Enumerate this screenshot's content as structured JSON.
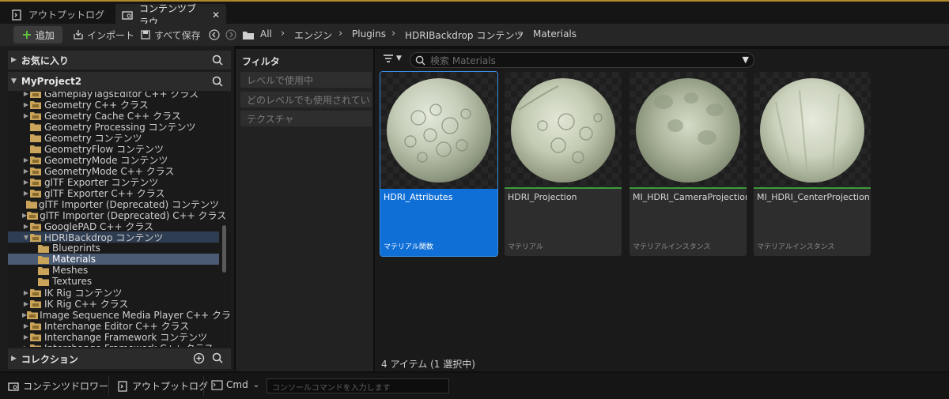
{
  "tabs": [
    {
      "label": "アウトプットログ",
      "active": false
    },
    {
      "label": "コンテンツブラウ...",
      "active": true
    }
  ],
  "tab_close": "✕",
  "toolbar": {
    "add_label": "追加",
    "import_label": "インポート",
    "save_all_label": "すべて保存"
  },
  "breadcrumb": [
    "All",
    "エンジン",
    "Plugins",
    "HDRIBackdrop コンテンツ",
    "Materials"
  ],
  "left_panel": {
    "favorites_label": "お気に入り",
    "project_label": "MyProject2",
    "collections_label": "コレクション",
    "tree": [
      {
        "label": "GameplayTagsEditor C++ クラス",
        "arrow": true
      },
      {
        "label": "Geometry C++ クラス",
        "arrow": true
      },
      {
        "label": "Geometry Cache C++ クラス",
        "arrow": true
      },
      {
        "label": "Geometry Processing コンテンツ",
        "arrow": false
      },
      {
        "label": "Geometry コンテンツ",
        "arrow": false
      },
      {
        "label": "GeometryFlow コンテンツ",
        "arrow": false
      },
      {
        "label": "GeometryMode コンテンツ",
        "arrow": true
      },
      {
        "label": "GeometryMode C++ クラス",
        "arrow": true
      },
      {
        "label": "glTF Exporter コンテンツ",
        "arrow": true
      },
      {
        "label": "glTF Exporter C++ クラス",
        "arrow": true
      },
      {
        "label": "glTF Importer (Deprecated) コンテンツ",
        "arrow": false
      },
      {
        "label": "glTF Importer (Deprecated) C++ クラス",
        "arrow": true
      },
      {
        "label": "GooglePAD C++ クラス",
        "arrow": true
      },
      {
        "label": "HDRIBackdrop コンテンツ",
        "arrow": true,
        "open": true
      },
      {
        "label": "Blueprints",
        "child": true
      },
      {
        "label": "Materials",
        "child": true,
        "selected": true
      },
      {
        "label": "Meshes",
        "child": true
      },
      {
        "label": "Textures",
        "child": true
      },
      {
        "label": "IK Rig コンテンツ",
        "arrow": true
      },
      {
        "label": "IK Rig C++ クラス",
        "arrow": true
      },
      {
        "label": "Image Sequence Media Player C++ クラス",
        "arrow": true
      },
      {
        "label": "Interchange Editor C++ クラス",
        "arrow": true
      },
      {
        "label": "Interchange Framework コンテンツ",
        "arrow": true
      },
      {
        "label": "Interchange Framework C++ クラス",
        "arrow": true
      }
    ]
  },
  "filters": {
    "title": "フィルタ",
    "chips": [
      "レベルで使用中",
      "どのレベルでも使用されていま",
      "テクスチャ"
    ]
  },
  "search": {
    "placeholder": "検索 Materials"
  },
  "assets": [
    {
      "name": "HDRI_Attributes",
      "type": "マテリアル関数",
      "selected": true
    },
    {
      "name": "HDRI_Projection",
      "type": "マテリアル",
      "selected": false
    },
    {
      "name": "MI_HDRI_CameraProjection",
      "type": "マテリアルインスタンス",
      "selected": false
    },
    {
      "name": "MI_HDRI_CenterProjection",
      "type": "マテリアルインスタンス",
      "selected": false
    }
  ],
  "status": {
    "count": "4 アイテム (1 選択中)"
  },
  "bottombar": {
    "content_drawer": "コンテンツドロワー",
    "output_log": "アウトプットログ",
    "cmd": "Cmd",
    "console_placeholder": "コンソールコマンドを入力します"
  }
}
